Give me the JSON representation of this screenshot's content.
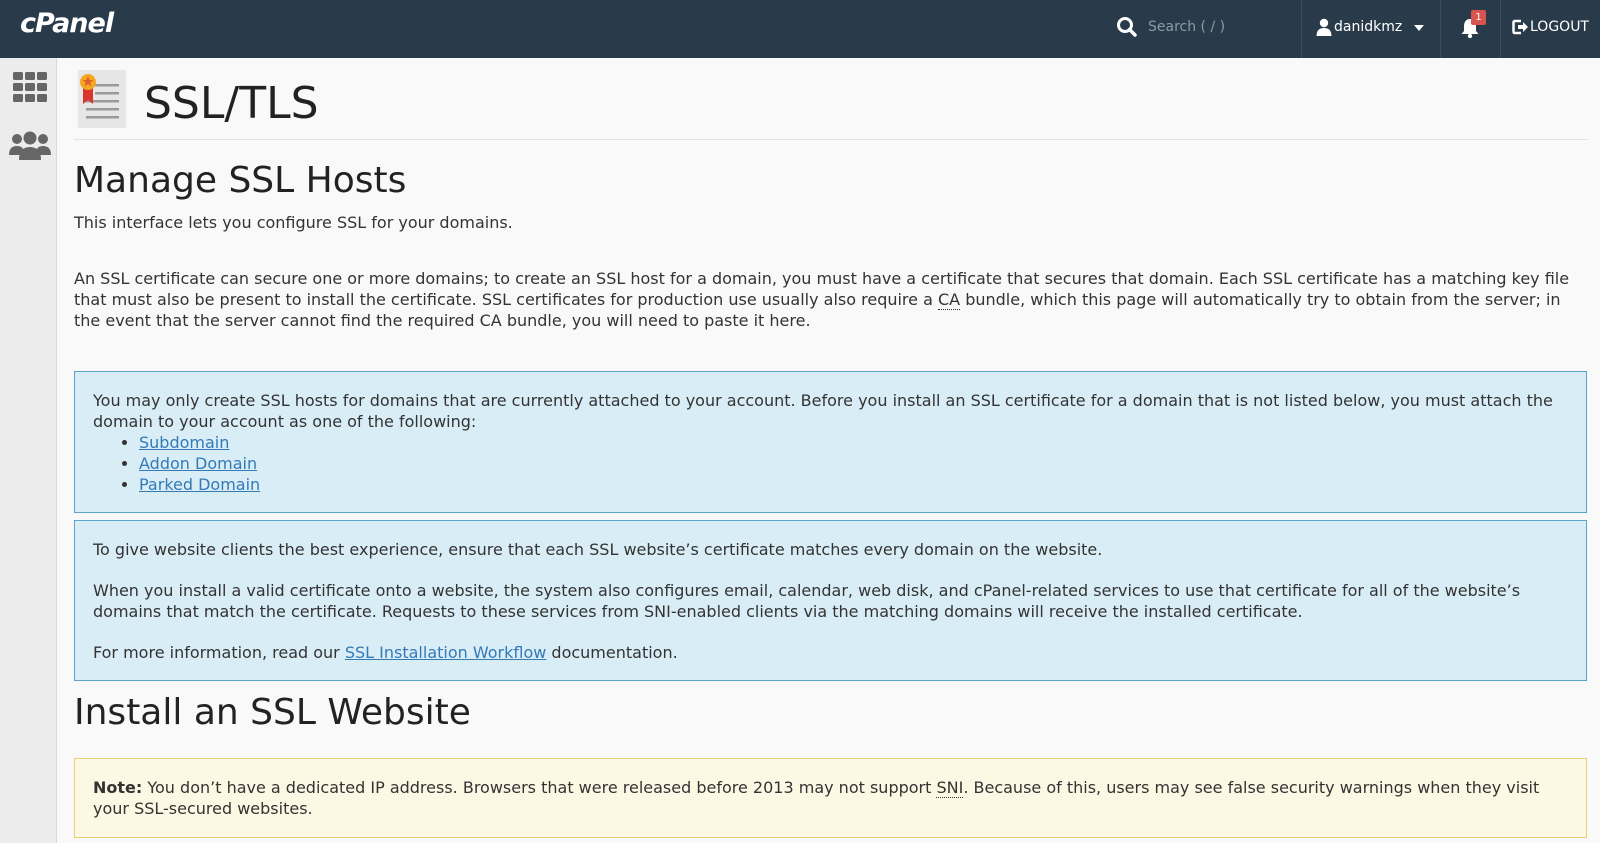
{
  "topbar": {
    "logo": "cPanel",
    "search_placeholder": "Search ( / )",
    "username": "danidkmz",
    "notification_count": "1",
    "logout": "LOGOUT"
  },
  "page": {
    "title": "SSL/TLS"
  },
  "manage": {
    "heading": "Manage SSL Hosts",
    "intro": "This interface lets you configure SSL for your domains.",
    "desc_part1": "An SSL certificate can secure one or more domains; to create an SSL host for a domain, you must have a certificate that secures that domain. Each SSL certificate has a matching key file that must also be present to install the certificate. SSL certificates for production use usually also require a ",
    "desc_abbr": "CA",
    "desc_part2": " bundle, which this page will automatically try to obtain from the server; in the event that the server cannot find the required CA bundle, you will need to paste it here."
  },
  "callout1": {
    "text": "You may only create SSL hosts for domains that are currently attached to your account. Before you install an SSL certificate for a domain that is not listed below, you must attach the domain to your account as one of the following:",
    "links": [
      "Subdomain",
      "Addon Domain",
      "Parked Domain"
    ]
  },
  "callout2": {
    "p1": "To give website clients the best experience, ensure that each SSL website’s certificate matches every domain on the website.",
    "p2": "When you install a valid certificate onto a website, the system also configures email, calendar, web disk, and cPanel-related services to use that certificate for all of the website’s domains that match the certificate. Requests to these services from SNI-enabled clients via the matching domains will receive the installed certificate.",
    "p3_before": "For more information, read our ",
    "p3_link": "SSL Installation Workflow",
    "p3_after": " documentation."
  },
  "install": {
    "heading": "Install an SSL Website",
    "note_label": "Note:",
    "note_part1": " You don’t have a dedicated IP address. Browsers that were released before 2013 may not support ",
    "note_abbr": "SNI",
    "note_part2": ". Because of this, users may see false security warnings when they visit your SSL-secured websites."
  },
  "colors": {
    "topbar": "#293a4a",
    "info_bg": "#d9edf7",
    "info_border": "#5ba4cc",
    "warn_bg": "#fcf8e3",
    "link": "#337ab7"
  }
}
